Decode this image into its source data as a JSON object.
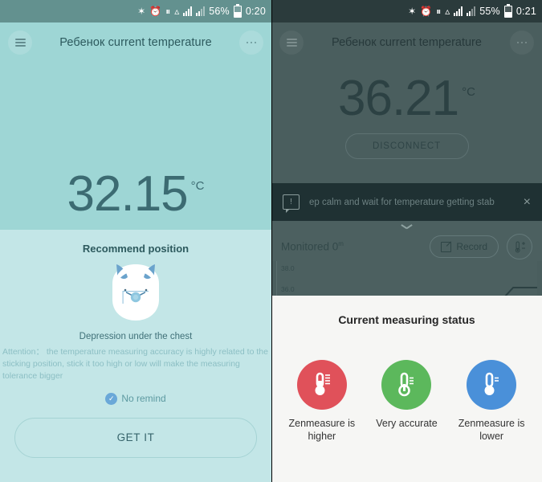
{
  "left": {
    "statusbar": {
      "icons": [
        "bluetooth-icon",
        "alarm-icon",
        "vibrate-icon",
        "wifi-icon",
        "signal-icon",
        "signal-icon-2"
      ],
      "bluetooth": "✶",
      "alarm": "⏱",
      "vibrate": "‖",
      "wifi": "◠",
      "battery_text": "56%",
      "time": "0:20"
    },
    "topbar": {
      "title": "Ребенок current temperature",
      "menu_icon": "hamburger-icon",
      "more_icon": "more-dots-icon"
    },
    "temperature": {
      "value": "32.15",
      "unit": "°C"
    },
    "recommend": {
      "title": "Recommend position",
      "illustration": "torso-sensor-illustration",
      "caption": "Depression under the chest",
      "attention": "Attention： the temperature measuring accuracy is highly related to the sticking position,\n stick it too high or low will make the measuring tolerance bigger"
    },
    "no_remind": {
      "label": "No remind",
      "checked_glyph": "✓"
    },
    "get_it_button": "GET IT"
  },
  "right": {
    "statusbar": {
      "battery_text": "55%",
      "time": "0:21"
    },
    "topbar": {
      "title": "Ребенок current temperature",
      "menu_icon": "hamburger-icon",
      "more_icon": "more-dots-icon"
    },
    "temperature": {
      "value": "36.21",
      "unit": "°C"
    },
    "disconnect_button": "DISCONNECT",
    "notification": {
      "icon": "alert-message-icon",
      "text": "ep calm and wait for temperature getting stab",
      "close_glyph": "×"
    },
    "monitored": {
      "label": "Monitored 0",
      "unit_sup": "m",
      "record_button": "Record",
      "thermometer_icon": "thermometer-adjust-icon",
      "collapse_icon": "chevron-down-icon"
    },
    "dialog": {
      "title": "Current measuring status",
      "items": [
        {
          "label": "Zenmeasure is higher",
          "color": "#e0515a",
          "icon": "thermometer-high-icon"
        },
        {
          "label": "Very accurate",
          "color": "#5cb85c",
          "icon": "thermometer-normal-icon"
        },
        {
          "label": "Zenmeasure is lower",
          "color": "#4a90d9",
          "icon": "thermometer-low-icon"
        }
      ]
    }
  },
  "chart_data": {
    "type": "line",
    "title": "",
    "xlabel": "",
    "ylabel": "",
    "yticks": [
      "38.0",
      "36.0"
    ],
    "ylim": [
      35.0,
      39.0
    ],
    "x": [
      0,
      1,
      2,
      3
    ],
    "values": [
      35.0,
      35.0,
      36.2,
      36.2
    ],
    "grid": false,
    "legend": "none",
    "line_color": "#2c4143"
  }
}
